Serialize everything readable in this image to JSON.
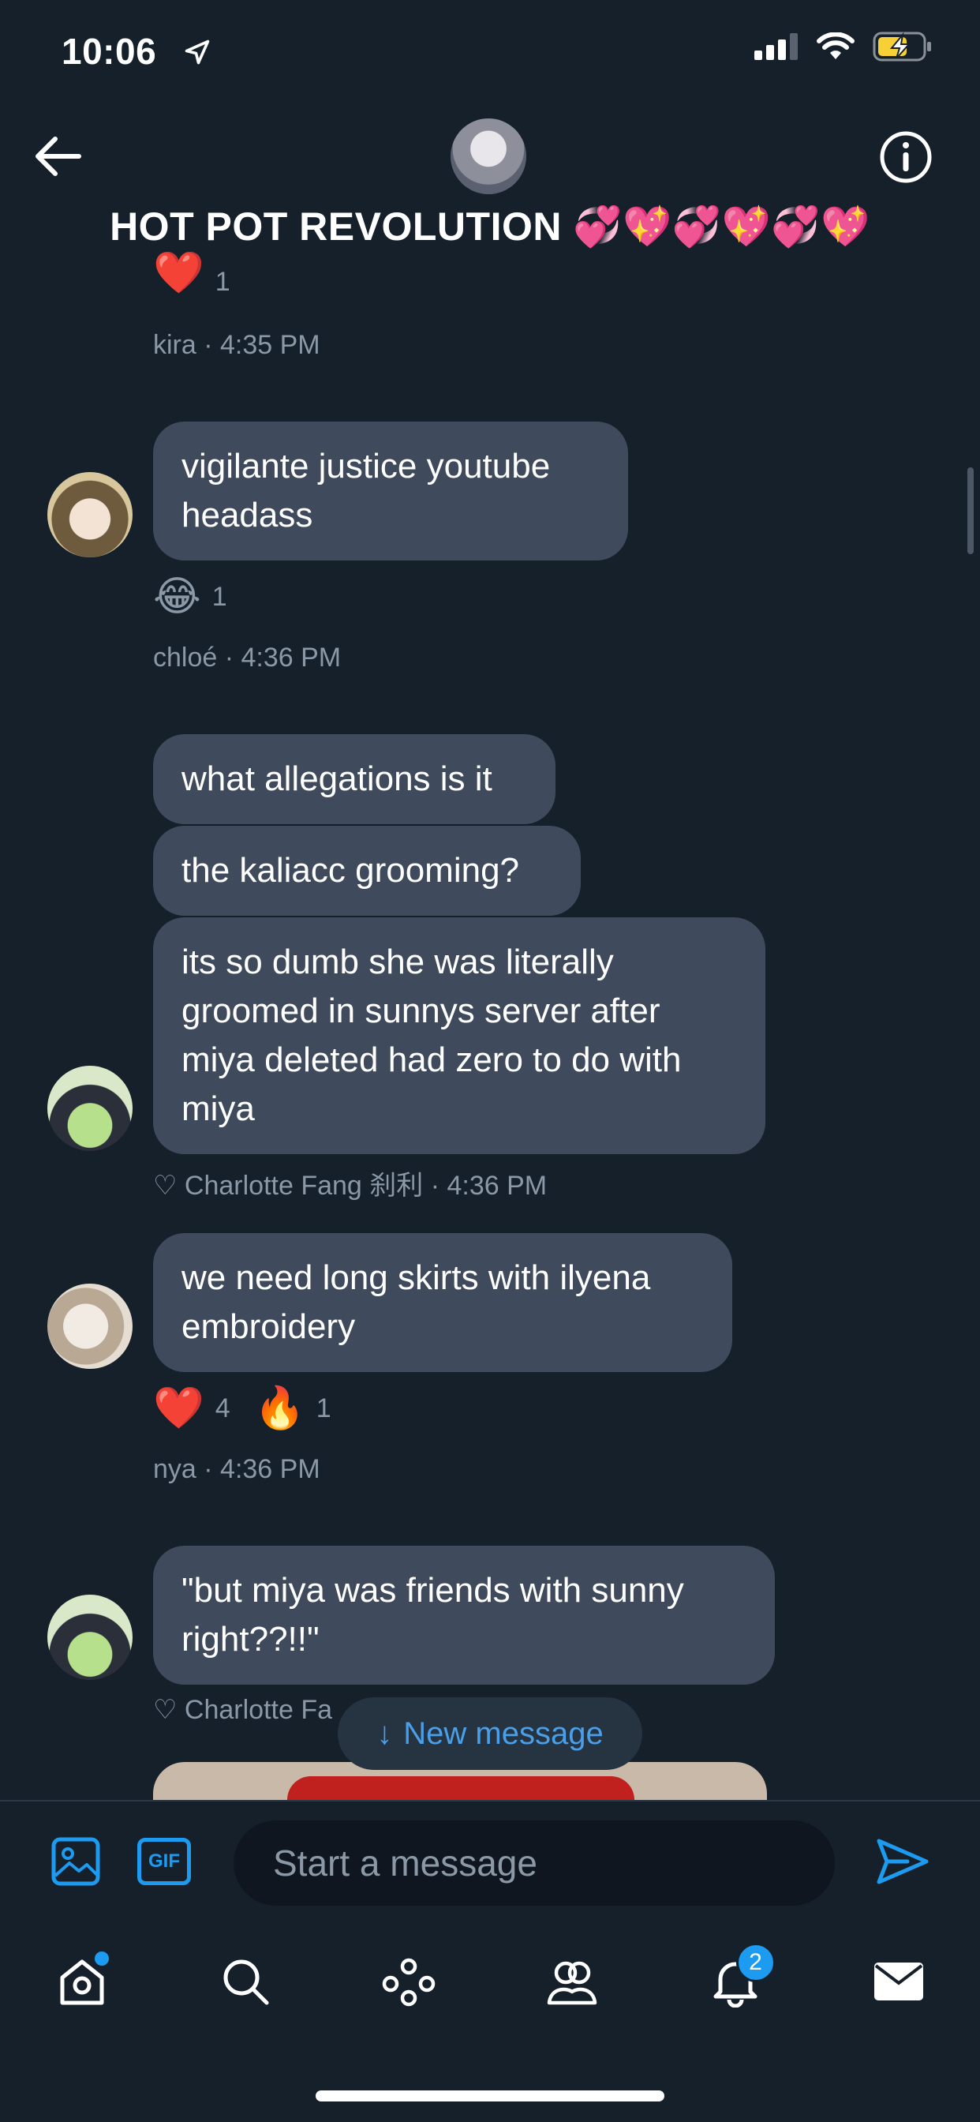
{
  "status_bar": {
    "time": "10:06"
  },
  "header": {
    "title": "HOT POT REVOLUTION 💞💖💞💖💞💖"
  },
  "messages": [
    {
      "reactions": [
        {
          "emoji": "❤️",
          "count": "1"
        }
      ],
      "meta": "kira  · 4:35 PM"
    },
    {
      "bubbles": [
        "vigilante justice youtube headass"
      ],
      "reactions": [
        {
          "emoji": "😂",
          "count": "1"
        }
      ],
      "meta": "chloé  · 4:36 PM"
    },
    {
      "bubbles": [
        "what allegations is it",
        "the kaliacc grooming?",
        "its so dumb she was literally groomed in sunnys server after miya deleted had zero to do with miya"
      ],
      "meta": "♡ Charlotte Fang 刹利  · 4:36 PM"
    },
    {
      "bubbles": [
        "we need long skirts with ilyena embroidery"
      ],
      "reactions": [
        {
          "emoji": "❤️",
          "count": "4"
        },
        {
          "emoji": "🔥",
          "count": "1"
        }
      ],
      "meta": "nya  · 4:36 PM"
    },
    {
      "bubbles": [
        "\"but miya was friends with sunny right??!!\""
      ],
      "meta": "♡ Charlotte Fa"
    }
  ],
  "new_message_pill": {
    "label": "New message",
    "arrow": "↓"
  },
  "composer": {
    "placeholder": "Start a message",
    "gif_label": "GIF"
  },
  "nav": {
    "notifications_badge": "2"
  },
  "colors": {
    "background": "#15202b",
    "bubble": "#3f4b5c",
    "accent": "#1d9bf0",
    "meta": "#8b98a5"
  }
}
